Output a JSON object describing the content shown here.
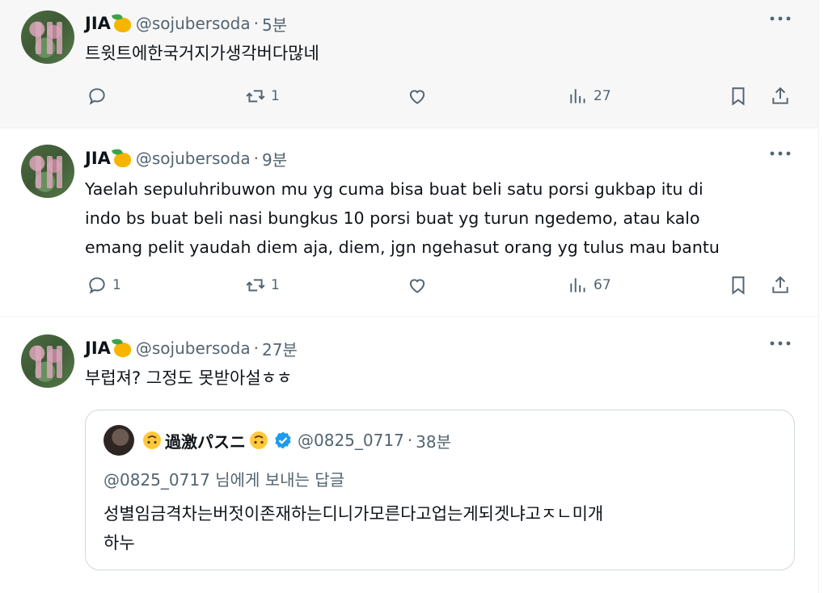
{
  "tweets": [
    {
      "name": "JIA",
      "handle": "@sojubersoda",
      "separator": "·",
      "time": "5분",
      "text": "트윗트에한국거지가생각버다많네",
      "counts": {
        "reply": "",
        "retweet": "1",
        "like": "",
        "views": "27"
      }
    },
    {
      "name": "JIA",
      "handle": "@sojubersoda",
      "separator": "·",
      "time": "9분",
      "text_lines": [
        "Yaelah sepuluhribuwon mu yg cuma bisa buat beli satu porsi gukbap itu di",
        "indo bs buat beli nasi bungkus 10 porsi buat yg turun ngedemo, atau kalo",
        "emang pelit yaudah diem aja, diem, jgn ngehasut orang yg tulus mau bantu"
      ],
      "counts": {
        "reply": "1",
        "retweet": "1",
        "like": "",
        "views": "67"
      }
    },
    {
      "name": "JIA",
      "handle": "@sojubersoda",
      "separator": "·",
      "time": "27분",
      "text": "부럽져? 그정도 못받아설ㅎㅎ",
      "quote": {
        "name": "過激パスニ",
        "handle": "@0825_0717",
        "separator": "·",
        "time": "38분",
        "reply_to": "@0825_0717 님에게 보내는 답글",
        "text_lines": [
          "성별임금격차는버젓이존재하는디니가모른다고업는게되겟냐고ㅈㄴ미개",
          "하누"
        ]
      }
    }
  ],
  "icons": [
    "mango-icon",
    "more-icon",
    "reply-icon",
    "retweet-icon",
    "like-icon",
    "views-icon",
    "bookmark-icon",
    "share-icon",
    "upside-down-face-icon",
    "verified-icon"
  ],
  "colors": {
    "secondary_text": "#536471",
    "verified": "#1d9bf0",
    "border": "#cfd9de"
  }
}
